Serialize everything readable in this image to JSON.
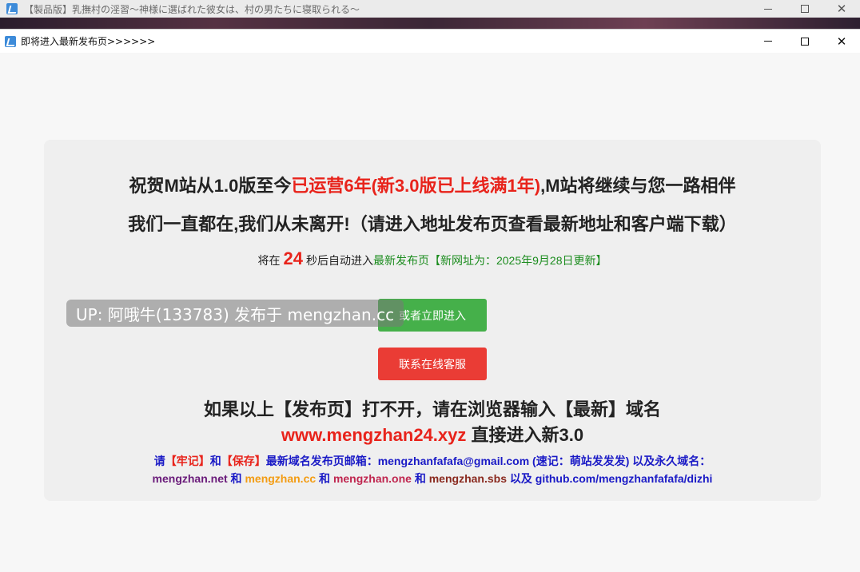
{
  "background_window": {
    "title": "【製品版】乳撫村の淫習～神様に選ばれた彼女は、村の男たちに寝取られる～",
    "app_icon": "app-icon"
  },
  "dialog": {
    "title": "即将进入最新发布页>>>>>>",
    "controls": {
      "minimize": "minimize-icon",
      "maximize": "maximize-icon",
      "close": "✕"
    }
  },
  "content": {
    "headline1": {
      "part1": "祝贺M站从1.0版至今",
      "part2": "已运营6年(新3.0版已上线满1年)",
      "part3": ",M站将继续与您一路相伴"
    },
    "headline2": "我们一直都在,我们从未离开!（请进入地址发布页查看最新地址和客户端下载）",
    "countdown": {
      "prefix": "将在",
      "seconds": "24",
      "suffix": "秒后自动进入",
      "link": "最新发布页【新网址为：2025年9月28日更新】"
    },
    "enter_button": "或者立即进入",
    "service_button": "联系在线客服",
    "domain_note": "如果以上【发布页】打不开，请在浏览器输入【最新】域名",
    "domain_url": "www.mengzhan24.xyz",
    "domain_url_suffix": " 直接进入新3.0",
    "mail_line": {
      "p1": "请",
      "p2": "【牢记】",
      "p3": "和",
      "p4": "【保存】",
      "p5": "最新域名发布页邮箱：mengzhanfafafa@gmail.com (速记：萌站发发发) 以及永久域名："
    },
    "domains_line": {
      "d1": "mengzhan.net",
      "and1": " 和 ",
      "d2": "mengzhan.cc",
      "and2": " 和 ",
      "d3": "mengzhan.one",
      "and3": " 和 ",
      "d4": "mengzhan.sbs",
      "and4": " 以及 ",
      "d5": "github.com/mengzhanfafafa/dizhi"
    }
  },
  "watermark": "UP: 阿哦牛(133783) 发布于 mengzhan.cc",
  "colors": {
    "red": "#e8231b",
    "green_button": "#45b04a",
    "red_button": "#ea3c35",
    "link_green": "#1b8c1e",
    "blue": "#1a1ac6"
  }
}
